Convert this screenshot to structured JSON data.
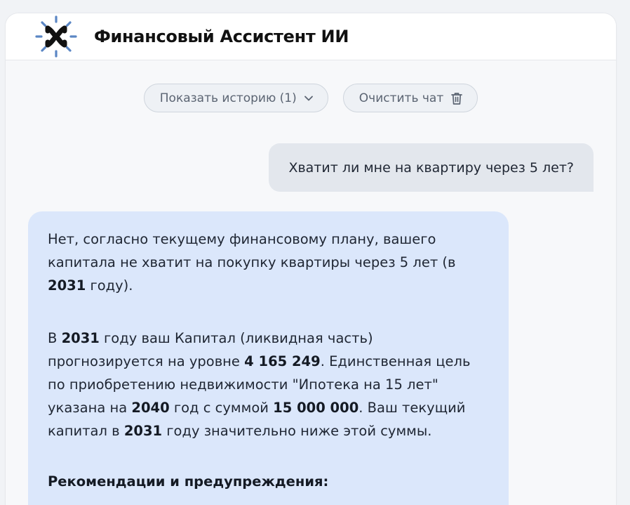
{
  "header": {
    "title": "Финансовый Ассистент ИИ",
    "logo_icon": "x-sun-logo-icon",
    "accent_color": "#5b86c4"
  },
  "controls": {
    "history_label": "Показать историю (1)",
    "history_icon": "chevron-down-icon",
    "clear_label": "Очистить чат",
    "clear_icon": "trash-icon"
  },
  "chat": {
    "user_message": "Хватит ли мне на квартиру через 5 лет?",
    "assistant": {
      "p1": {
        "t1": "Нет, согласно текущему финансовому плану, вашего капитала не хватит на покупку квартиры через 5 лет (в ",
        "b1": "2031",
        "t2": " году)."
      },
      "p2": {
        "t1": "В ",
        "b1": "2031",
        "t2": " году ваш Капитал (ликвидная часть) прогнозируется на уровне ",
        "b2": "4 165 249",
        "t3": ". Единственная цель по приобретению недвижимости \"Ипотека на 15 лет\" указана на ",
        "b3": "2040",
        "t4": " год с суммой ",
        "b4": "15 000 000",
        "t5": ". Ваш текущий капитал в ",
        "b5": "2031",
        "t6": " году значительно ниже этой суммы."
      },
      "heading": "Рекомендации и предупреждения:"
    }
  },
  "colors": {
    "user_bubble": "#e3e7ed",
    "assistant_bubble": "#dbe7fb",
    "background": "#f7f8fa"
  }
}
